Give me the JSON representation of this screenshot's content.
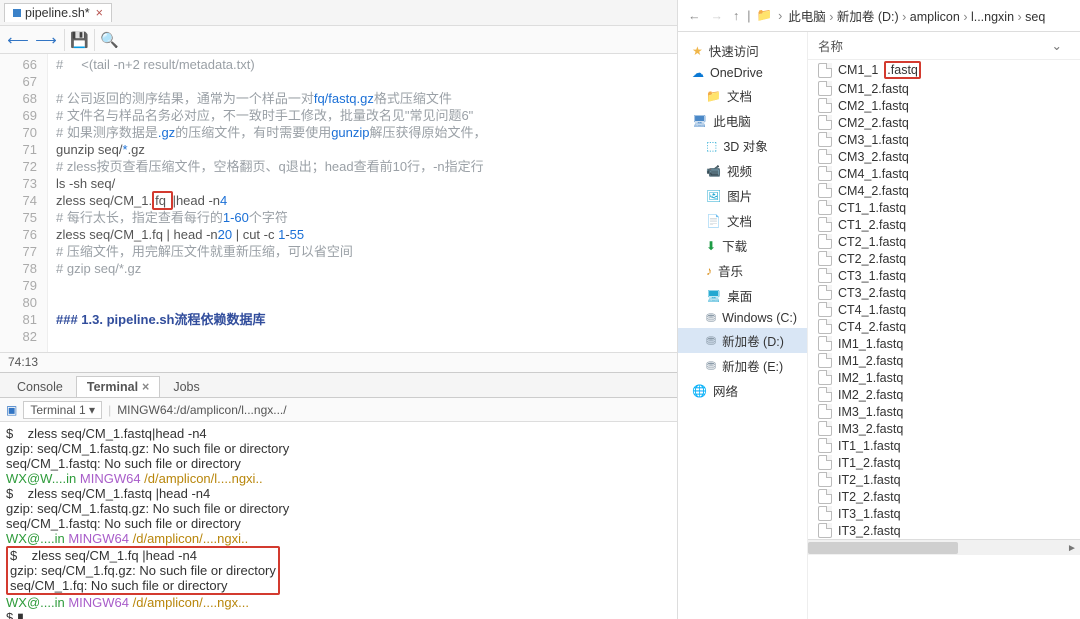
{
  "editor": {
    "tab_title": "pipeline.sh*",
    "status": "74:13",
    "gutter_start": 66,
    "lines": [
      {
        "n": 66,
        "html": "<span class='c-comment'>#     &lt;(tail -n+2 result/metadata.txt)</span>"
      },
      {
        "n": 67,
        "html": ""
      },
      {
        "n": 68,
        "html": "<span class='c-comment'># 公司返回的测序结果，通常为一个样品一对</span><span class='c-path'>fq/fastq.gz</span><span class='c-comment'>格式压缩文件</span>"
      },
      {
        "n": 69,
        "html": "<span class='c-comment'># 文件名与样品名务必对应，不一致时手工修改，批量改名见\"常见问题6\"</span>"
      },
      {
        "n": 70,
        "html": "<span class='c-comment'># 如果测序数据是</span><span class='c-path'>.gz</span><span class='c-comment'>的压缩文件，有时需要使用</span><span class='c-path'>gunzip</span><span class='c-comment'>解压获得原始文件，</span>"
      },
      {
        "n": 71,
        "html": "gunzip seq/<span class='c-path'>*</span>.gz"
      },
      {
        "n": 72,
        "html": "<span class='c-comment'># zless按页查看压缩文件，空格翻页、q退出；head查看前10行，-n指定行</span>"
      },
      {
        "n": 73,
        "html": "ls -sh seq/"
      },
      {
        "n": 74,
        "html": "zless seq/CM_1.<span class='hl-box'>fq </span>|head -n<span class='c-num'>4</span>"
      },
      {
        "n": 75,
        "html": "<span class='c-comment'># 每行太长，指定查看每行的</span><span class='c-num'>1-60</span><span class='c-comment'>个字符</span>"
      },
      {
        "n": 76,
        "html": "zless seq/CM_1.fq | head -n<span class='c-num'>20</span> | cut -c <span class='c-num'>1</span>-<span class='c-num'>55</span>"
      },
      {
        "n": 77,
        "html": "<span class='c-comment'># 压缩文件，用完解压文件就重新压缩，可以省空间</span>"
      },
      {
        "n": 78,
        "html": "<span class='c-comment'># gzip seq/*.gz</span>"
      },
      {
        "n": 79,
        "html": ""
      },
      {
        "n": 80,
        "html": ""
      },
      {
        "n": 81,
        "html": "<span class='c-head'>### 1.3. pipeline.sh流程依赖数据库</span>"
      },
      {
        "n": 82,
        "html": ""
      }
    ]
  },
  "panel": {
    "tabs": [
      "Console",
      "Terminal",
      "Jobs"
    ],
    "active": 1,
    "term_dd": "Terminal 1",
    "term_path": "MINGW64:/d/amplicon/l...ngx.../",
    "lines": [
      "$    zless seq/CM_1.fastq|head -n4",
      "gzip: seq/CM_1.fastq.gz: No such file or directory",
      "seq/CM_1.fastq: No such file or directory",
      "",
      {
        "seg": [
          {
            "t": "WX@W....in ",
            "c": "t-green"
          },
          {
            "t": "MINGW64 ",
            "c": "t-purple"
          },
          {
            "t": "/d/amplicon/l....ngxi..",
            "c": "t-yellow"
          }
        ]
      },
      "$    zless seq/CM_1.fastq |head -n4",
      "gzip: seq/CM_1.fastq.gz: No such file or directory",
      "seq/CM_1.fastq: No such file or directory",
      "",
      {
        "seg": [
          {
            "t": "WX@....in ",
            "c": "t-green"
          },
          {
            "t": "MINGW64 ",
            "c": "t-purple"
          },
          {
            "t": "/d/amplicon/....ngxi..",
            "c": "t-yellow"
          }
        ]
      },
      {
        "box": [
          "$    zless seq/CM_1.fq |head -n4",
          "gzip: seq/CM_1.fq.gz: No such file or directory",
          "seq/CM_1.fq: No such file or directory"
        ]
      },
      "",
      {
        "seg": [
          {
            "t": "WX@....in ",
            "c": "t-green"
          },
          {
            "t": "MINGW64 ",
            "c": "t-purple"
          },
          {
            "t": "/d/amplicon/....ngx...",
            "c": "t-yellow"
          }
        ]
      },
      "$ ▮"
    ]
  },
  "explorer": {
    "breadcrumb": [
      "此电脑",
      "新加卷 (D:)",
      "amplicon",
      "l...ngxin",
      "seq"
    ],
    "col_header": "名称",
    "nav": [
      {
        "label": "快速访问",
        "icon": "star",
        "ind": 0
      },
      {
        "label": "OneDrive",
        "icon": "cloud",
        "ind": 0
      },
      {
        "label": "文档",
        "icon": "folder",
        "ind": 1
      },
      {
        "label": "此电脑",
        "icon": "pc",
        "ind": 0
      },
      {
        "label": "3D 对象",
        "icon": "cube",
        "ind": 1
      },
      {
        "label": "视频",
        "icon": "video",
        "ind": 1
      },
      {
        "label": "图片",
        "icon": "image",
        "ind": 1
      },
      {
        "label": "文档",
        "icon": "doc",
        "ind": 1
      },
      {
        "label": "下载",
        "icon": "download",
        "ind": 1
      },
      {
        "label": "音乐",
        "icon": "music",
        "ind": 1
      },
      {
        "label": "桌面",
        "icon": "desktop",
        "ind": 1
      },
      {
        "label": "Windows (C:)",
        "icon": "drive",
        "ind": 1
      },
      {
        "label": "新加卷 (D:)",
        "icon": "drive",
        "ind": 1,
        "sel": true
      },
      {
        "label": "新加卷 (E:)",
        "icon": "drive",
        "ind": 1
      },
      {
        "label": "网络",
        "icon": "net",
        "ind": 0
      }
    ],
    "files": [
      {
        "name": "CM1_1",
        "ext": ".fastq",
        "hl": true
      },
      {
        "name": "CM1_2.fastq"
      },
      {
        "name": "CM2_1.fastq"
      },
      {
        "name": "CM2_2.fastq"
      },
      {
        "name": "CM3_1.fastq"
      },
      {
        "name": "CM3_2.fastq"
      },
      {
        "name": "CM4_1.fastq"
      },
      {
        "name": "CM4_2.fastq"
      },
      {
        "name": "CT1_1.fastq"
      },
      {
        "name": "CT1_2.fastq"
      },
      {
        "name": "CT2_1.fastq"
      },
      {
        "name": "CT2_2.fastq"
      },
      {
        "name": "CT3_1.fastq"
      },
      {
        "name": "CT3_2.fastq"
      },
      {
        "name": "CT4_1.fastq"
      },
      {
        "name": "CT4_2.fastq"
      },
      {
        "name": "IM1_1.fastq"
      },
      {
        "name": "IM1_2.fastq"
      },
      {
        "name": "IM2_1.fastq"
      },
      {
        "name": "IM2_2.fastq"
      },
      {
        "name": "IM3_1.fastq"
      },
      {
        "name": "IM3_2.fastq"
      },
      {
        "name": "IT1_1.fastq"
      },
      {
        "name": "IT1_2.fastq"
      },
      {
        "name": "IT2_1.fastq"
      },
      {
        "name": "IT2_2.fastq"
      },
      {
        "name": "IT3_1.fastq"
      },
      {
        "name": "IT3_2.fastq"
      }
    ]
  }
}
